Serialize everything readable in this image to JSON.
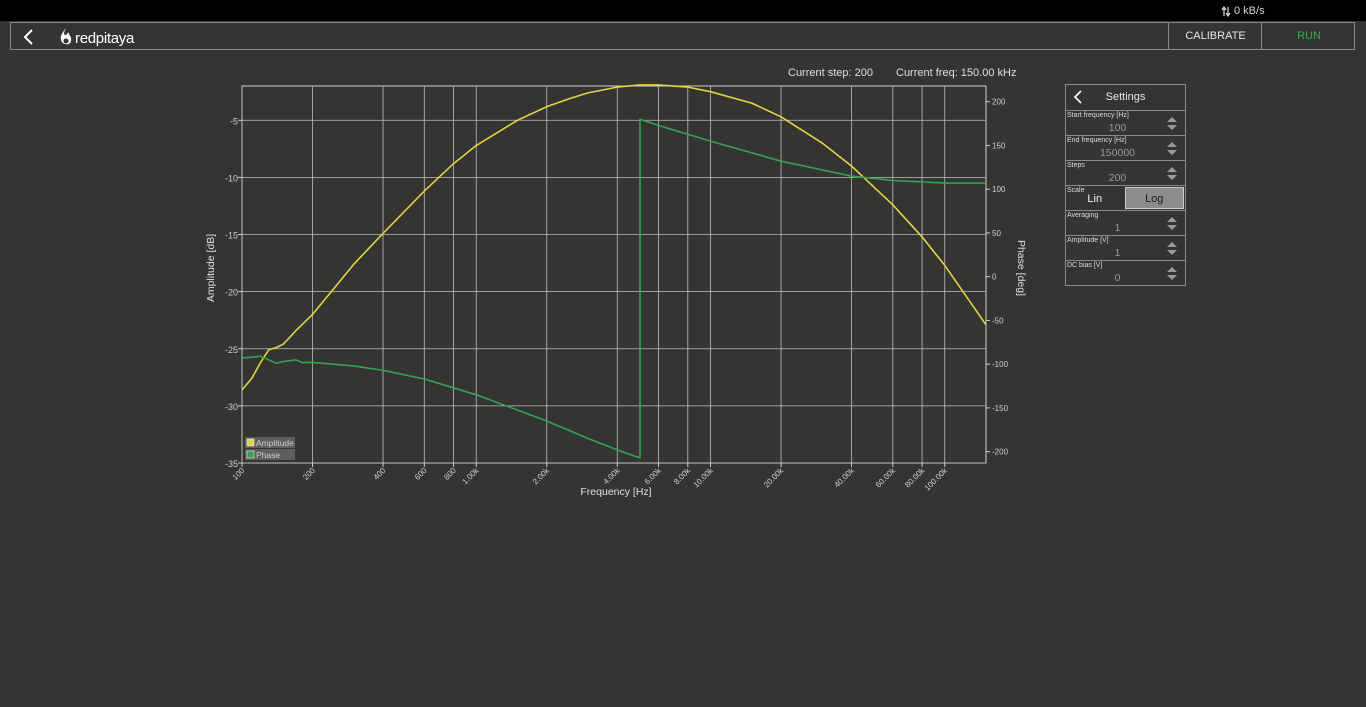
{
  "status": {
    "transfer_rate": "0 kB/s"
  },
  "header": {
    "logo_text": "redpitaya",
    "calibrate_label": "CALIBRATE",
    "run_label": "RUN"
  },
  "info": {
    "step": "Current step: 200",
    "freq": "Current freq: 150.00 kHz"
  },
  "settings": {
    "title": "Settings",
    "start_freq": {
      "label": "Start frequency [Hz]",
      "value": "100"
    },
    "end_freq": {
      "label": "End frequency [Hz]",
      "value": "150000"
    },
    "steps": {
      "label": "Steps",
      "value": "200"
    },
    "scale": {
      "label": "Scale",
      "options": [
        "Lin",
        "Log"
      ],
      "selected": "Log"
    },
    "averaging": {
      "label": "Averaging",
      "value": "1"
    },
    "amplitude": {
      "label": "Amplitude [V]",
      "value": "1"
    },
    "dc_bias": {
      "label": "DC bias [V]",
      "value": "0"
    }
  },
  "icons": [
    "transfer-arrows-icon",
    "back-icon",
    "redpitaya-logo-icon",
    "settings-back-icon",
    "spinner-arrows-icon"
  ],
  "colors": {
    "amplitude": "#e8d52c",
    "phase": "#2aa84a",
    "run": "#2fb34a",
    "background": "#343433"
  },
  "chart_data": {
    "type": "line",
    "xlabel": "Frequency [Hz]",
    "ylabel": "Amplitude [dB]",
    "y2label": "Phase [deg]",
    "xscale": "log",
    "xlim": [
      100,
      150000
    ],
    "ylim": [
      -35,
      -2
    ],
    "y2lim": [
      -213,
      218
    ],
    "grid": true,
    "legend_position": "bottom-left",
    "x_ticks": [
      100,
      200,
      400,
      600,
      800,
      1000,
      2000,
      4000,
      6000,
      8000,
      10000,
      20000,
      40000,
      60000,
      80000,
      100000
    ],
    "x_tick_labels": [
      "100",
      "200",
      "400",
      "600",
      "800",
      "1.00k",
      "2.00k",
      "4.00k",
      "6.00k",
      "8.00k",
      "10.00k",
      "20.00k",
      "40.00k",
      "60.00k",
      "80.00k",
      "100.00k"
    ],
    "y_ticks": [
      -5,
      -10,
      -15,
      -20,
      -25,
      -30,
      -35
    ],
    "y2_ticks": [
      200,
      150,
      100,
      50,
      0,
      -50,
      -100,
      -150,
      -200
    ],
    "series": [
      {
        "name": "Amplitude",
        "axis": "left",
        "x": [
          100,
          110,
          120,
          130,
          140,
          150,
          160,
          170,
          180,
          200,
          300,
          400,
          600,
          800,
          1000,
          1500,
          2000,
          2500,
          3000,
          4000,
          5000,
          6000,
          8000,
          10000,
          15000,
          20000,
          30000,
          40000,
          60000,
          80000,
          100000,
          150000
        ],
        "y": [
          -28.6,
          -27.6,
          -26.2,
          -25.1,
          -24.9,
          -24.6,
          -24.0,
          -23.4,
          -22.9,
          -22.0,
          -17.6,
          -14.9,
          -11.2,
          -8.8,
          -7.2,
          -5.0,
          -3.8,
          -3.1,
          -2.6,
          -2.1,
          -1.9,
          -1.9,
          -2.1,
          -2.5,
          -3.5,
          -4.7,
          -7.0,
          -9.0,
          -12.4,
          -15.2,
          -17.7,
          -22.9
        ]
      },
      {
        "name": "Phase",
        "axis": "right",
        "x": [
          100,
          110,
          120,
          130,
          140,
          150,
          160,
          170,
          180,
          200,
          300,
          400,
          600,
          800,
          1000,
          2000,
          3000,
          4000,
          4500,
          5000,
          5001,
          6000,
          10000,
          20000,
          40000,
          60000,
          100000,
          150000
        ],
        "y": [
          -93,
          -92,
          -91,
          -95,
          -99,
          -97,
          -96,
          -95,
          -98,
          -98,
          -102,
          -107,
          -117,
          -127,
          -135,
          -165,
          -185,
          -198,
          -203,
          -207,
          180,
          173,
          155,
          132,
          115,
          110,
          107,
          107
        ]
      }
    ]
  }
}
